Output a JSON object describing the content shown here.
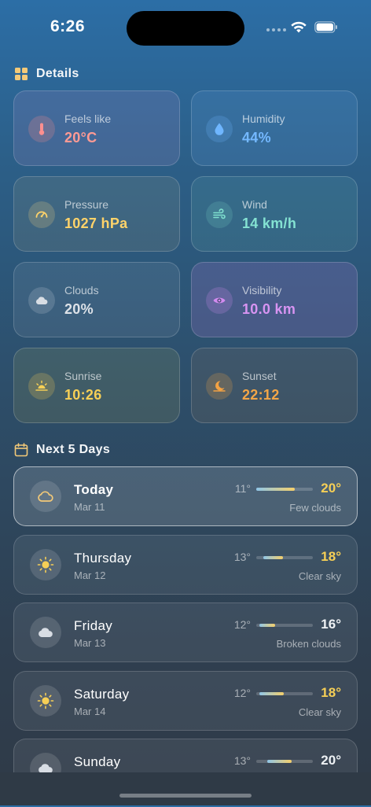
{
  "status_bar": {
    "time": "6:26"
  },
  "details": {
    "title": "Details",
    "cards": [
      {
        "label": "Feels like",
        "value": "20°C",
        "icon": "thermometer-icon",
        "color": "#ff8f8f"
      },
      {
        "label": "Humidity",
        "value": "44%",
        "icon": "water-drop-icon",
        "color": "#6fb6ff"
      },
      {
        "label": "Pressure",
        "value": "1027 hPa",
        "icon": "gauge-icon",
        "color": "#ffd36a"
      },
      {
        "label": "Wind",
        "value": "14 km/h",
        "icon": "wind-icon",
        "color": "#7fe0cf"
      },
      {
        "label": "Clouds",
        "value": "20%",
        "icon": "cloud-icon",
        "color": "#d8dde4"
      },
      {
        "label": "Visibility",
        "value": "10.0 km",
        "icon": "eye-icon",
        "color": "#d28bf0"
      },
      {
        "label": "Sunrise",
        "value": "10:26",
        "icon": "sunrise-icon",
        "color": "#f6cf56"
      },
      {
        "label": "Sunset",
        "value": "22:12",
        "icon": "sunset-icon",
        "color": "#f3a243"
      }
    ]
  },
  "forecast": {
    "title": "Next 5 Days",
    "days": [
      {
        "name": "Today",
        "date": "Mar 11",
        "low": "11°",
        "high": "20°",
        "desc": "Few clouds",
        "icon": "cloud-outline-icon",
        "bar_start": 0,
        "bar_end": 0.68
      },
      {
        "name": "Thursday",
        "date": "Mar 12",
        "low": "13°",
        "high": "18°",
        "desc": "Clear sky",
        "icon": "sun-icon",
        "bar_start": 0.12,
        "bar_end": 0.47
      },
      {
        "name": "Friday",
        "date": "Mar 13",
        "low": "12°",
        "high": "16°",
        "desc": "Broken clouds",
        "icon": "cloud-icon",
        "bar_start": 0.05,
        "bar_end": 0.33
      },
      {
        "name": "Saturday",
        "date": "Mar 14",
        "low": "12°",
        "high": "18°",
        "desc": "Clear sky",
        "icon": "sun-icon",
        "bar_start": 0.05,
        "bar_end": 0.48
      },
      {
        "name": "Sunday",
        "date": "",
        "low": "13°",
        "high": "20°",
        "desc": "",
        "icon": "cloud-icon",
        "bar_start": 0.2,
        "bar_end": 0.62
      }
    ]
  }
}
